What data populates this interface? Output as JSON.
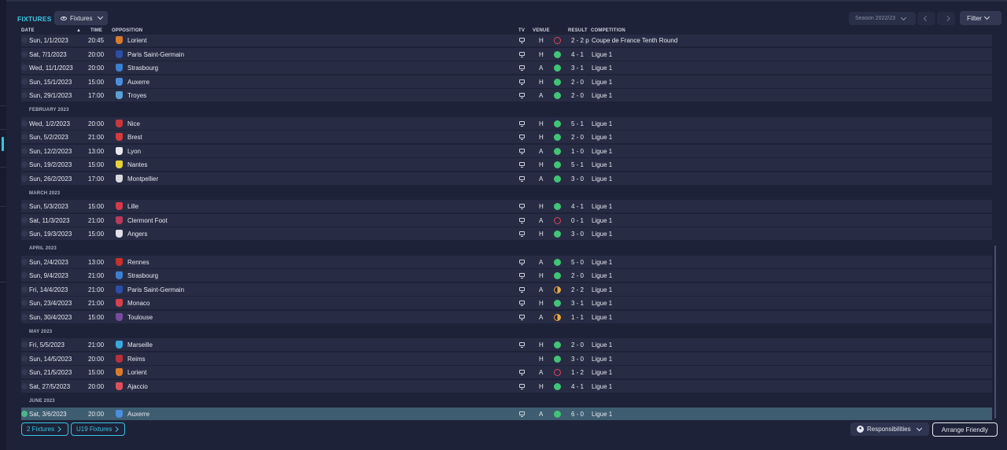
{
  "colors": {
    "accent": "#37c6e3",
    "win": "#3ec773",
    "loss": "#e0455a",
    "draw": "#f2a93b",
    "selected_row": "#3e5d70"
  },
  "header": {
    "title": "FIXTURES",
    "view_label": "Fixtures",
    "season_label": "Season 2022/23",
    "filter_label": "Filter"
  },
  "columns": {
    "date": "DATE",
    "time": "TIME",
    "opposition": "OPPOSITION",
    "tv": "TV",
    "venue": "VENUE",
    "result": "RESULT",
    "competition": "COMPETITION"
  },
  "fixtures": [
    {
      "kind": "row",
      "date": "Sun, 1/1/2023",
      "time": "20:45",
      "opp": "Lorient",
      "crest": "#d97a2b",
      "tv": true,
      "venue": "H",
      "outcome": "L",
      "score": "2 - 2 p",
      "comp": "Coupe de France Tenth Round"
    },
    {
      "kind": "row",
      "date": "Sat, 7/1/2023",
      "time": "20:00",
      "opp": "Paris Saint-Germain",
      "crest": "#2b4ea8",
      "tv": true,
      "venue": "H",
      "outcome": "W",
      "score": "4 - 1",
      "comp": "Ligue 1"
    },
    {
      "kind": "row",
      "date": "Wed, 11/1/2023",
      "time": "20:00",
      "opp": "Strasbourg",
      "crest": "#3a7fd0",
      "tv": true,
      "venue": "A",
      "outcome": "W",
      "score": "3 - 1",
      "comp": "Ligue 1"
    },
    {
      "kind": "row",
      "date": "Sun, 15/1/2023",
      "time": "15:00",
      "opp": "Auxerre",
      "crest": "#4a8ee0",
      "tv": true,
      "venue": "H",
      "outcome": "W",
      "score": "2 - 0",
      "comp": "Ligue 1"
    },
    {
      "kind": "row",
      "date": "Sun, 29/1/2023",
      "time": "17:00",
      "opp": "Troyes",
      "crest": "#5aa0d8",
      "tv": true,
      "venue": "A",
      "outcome": "W",
      "score": "2 - 0",
      "comp": "Ligue 1"
    },
    {
      "kind": "month",
      "label": "FEBRUARY 2023"
    },
    {
      "kind": "row",
      "date": "Wed, 1/2/2023",
      "time": "20:00",
      "opp": "Nice",
      "crest": "#c8383a",
      "tv": true,
      "venue": "H",
      "outcome": "W",
      "score": "5 - 1",
      "comp": "Ligue 1"
    },
    {
      "kind": "row",
      "date": "Sun, 5/2/2023",
      "time": "21:00",
      "opp": "Brest",
      "crest": "#d63a3a",
      "tv": true,
      "venue": "H",
      "outcome": "W",
      "score": "2 - 0",
      "comp": "Ligue 1"
    },
    {
      "kind": "row",
      "date": "Sun, 12/2/2023",
      "time": "13:00",
      "opp": "Lyon",
      "crest": "#e8e8f0",
      "tv": true,
      "venue": "A",
      "outcome": "W",
      "score": "1 - 0",
      "comp": "Ligue 1"
    },
    {
      "kind": "row",
      "date": "Sun, 19/2/2023",
      "time": "15:00",
      "opp": "Nantes",
      "crest": "#e8d23a",
      "tv": true,
      "venue": "H",
      "outcome": "W",
      "score": "5 - 1",
      "comp": "Ligue 1"
    },
    {
      "kind": "row",
      "date": "Sun, 26/2/2023",
      "time": "17:00",
      "opp": "Montpellier",
      "crest": "#d8d8e0",
      "tv": true,
      "venue": "A",
      "outcome": "W",
      "score": "3 - 0",
      "comp": "Ligue 1"
    },
    {
      "kind": "month",
      "label": "MARCH 2023"
    },
    {
      "kind": "row",
      "date": "Sun, 5/3/2023",
      "time": "15:00",
      "opp": "Lille",
      "crest": "#d63a4a",
      "tv": true,
      "venue": "H",
      "outcome": "W",
      "score": "4 - 1",
      "comp": "Ligue 1"
    },
    {
      "kind": "row",
      "date": "Sat, 11/3/2023",
      "time": "21:00",
      "opp": "Clermont Foot",
      "crest": "#b83a5a",
      "tv": true,
      "venue": "A",
      "outcome": "L",
      "score": "0 - 1",
      "comp": "Ligue 1"
    },
    {
      "kind": "row",
      "date": "Sun, 19/3/2023",
      "time": "15:00",
      "opp": "Angers",
      "crest": "#e0e0e8",
      "tv": true,
      "venue": "H",
      "outcome": "W",
      "score": "3 - 0",
      "comp": "Ligue 1"
    },
    {
      "kind": "month",
      "label": "APRIL 2023"
    },
    {
      "kind": "row",
      "date": "Sun, 2/4/2023",
      "time": "13:00",
      "opp": "Rennes",
      "crest": "#c8302a",
      "tv": true,
      "venue": "A",
      "outcome": "W",
      "score": "5 - 0",
      "comp": "Ligue 1"
    },
    {
      "kind": "row",
      "date": "Sun, 9/4/2023",
      "time": "21:00",
      "opp": "Strasbourg",
      "crest": "#3a7fd0",
      "tv": true,
      "venue": "H",
      "outcome": "W",
      "score": "2 - 0",
      "comp": "Ligue 1"
    },
    {
      "kind": "row",
      "date": "Fri, 14/4/2023",
      "time": "21:00",
      "opp": "Paris Saint-Germain",
      "crest": "#2b4ea8",
      "tv": true,
      "venue": "A",
      "outcome": "D",
      "score": "2 - 2",
      "comp": "Ligue 1"
    },
    {
      "kind": "row",
      "date": "Sun, 23/4/2023",
      "time": "21:00",
      "opp": "Monaco",
      "crest": "#d8404a",
      "tv": true,
      "venue": "H",
      "outcome": "W",
      "score": "3 - 1",
      "comp": "Ligue 1"
    },
    {
      "kind": "row",
      "date": "Sun, 30/4/2023",
      "time": "15:00",
      "opp": "Toulouse",
      "crest": "#7a4aa0",
      "tv": true,
      "venue": "A",
      "outcome": "D",
      "score": "1 - 1",
      "comp": "Ligue 1"
    },
    {
      "kind": "month",
      "label": "MAY 2023"
    },
    {
      "kind": "row",
      "date": "Fri, 5/5/2023",
      "time": "21:00",
      "opp": "Marseille",
      "crest": "#3aa8e0",
      "tv": true,
      "venue": "H",
      "outcome": "W",
      "score": "2 - 0",
      "comp": "Ligue 1"
    },
    {
      "kind": "row",
      "date": "Sun, 14/5/2023",
      "time": "20:00",
      "opp": "Reims",
      "crest": "#b8303a",
      "tv": false,
      "venue": "H",
      "outcome": "W",
      "score": "3 - 0",
      "comp": "Ligue 1"
    },
    {
      "kind": "row",
      "date": "Sun, 21/5/2023",
      "time": "15:00",
      "opp": "Lorient",
      "crest": "#d97a2b",
      "tv": true,
      "venue": "A",
      "outcome": "L",
      "score": "1 - 2",
      "comp": "Ligue 1"
    },
    {
      "kind": "row",
      "date": "Sat, 27/5/2023",
      "time": "20:00",
      "opp": "Ajaccio",
      "crest": "#e0505a",
      "tv": true,
      "venue": "H",
      "outcome": "W",
      "score": "4 - 1",
      "comp": "Ligue 1"
    },
    {
      "kind": "month",
      "label": "JUNE 2023"
    },
    {
      "kind": "row",
      "date": "Sat, 3/6/2023",
      "time": "20:00",
      "opp": "Auxerre",
      "crest": "#4a8ee0",
      "tv": true,
      "venue": "A",
      "outcome": "W",
      "score": "6 - 0",
      "comp": "Ligue 1",
      "selected": true
    }
  ],
  "footer": {
    "fixtures_2": "2 Fixtures",
    "fixtures_u19": "U19 Fixtures",
    "responsibilities": "Responsibilities",
    "arrange_friendly": "Arrange Friendly"
  }
}
